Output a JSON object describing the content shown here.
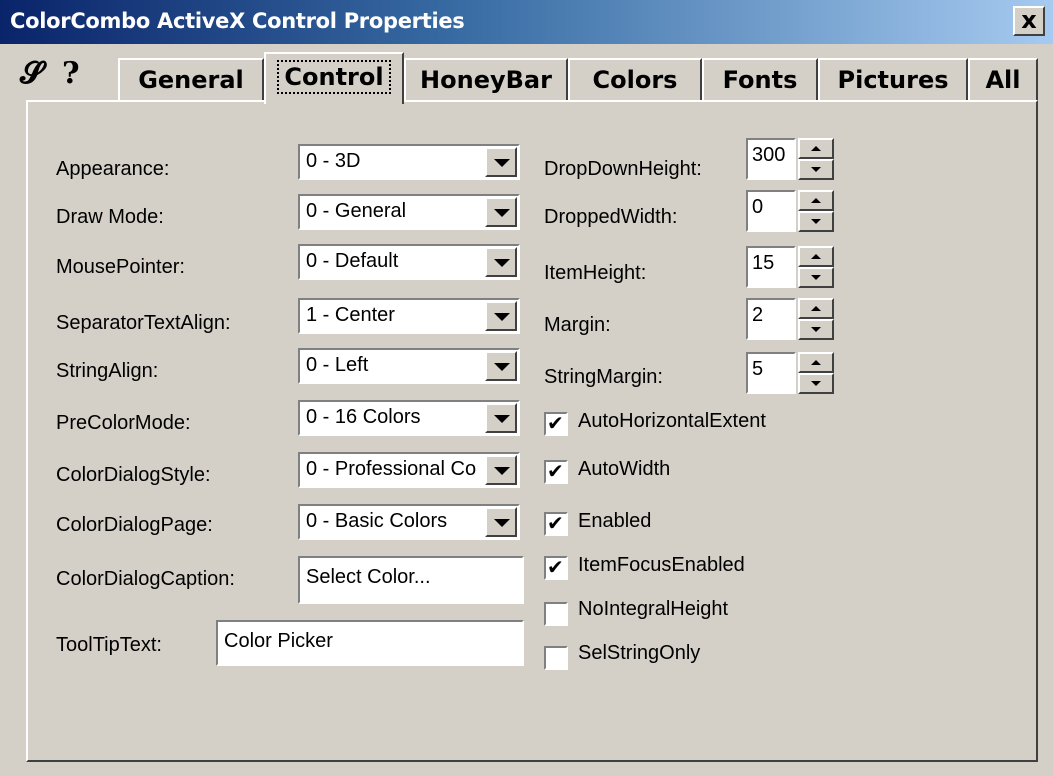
{
  "window": {
    "title": "ColorCombo ActiveX Control Properties",
    "close_glyph": "x"
  },
  "icons": [
    "pin-icon",
    "help-icon"
  ],
  "tabs": [
    {
      "label": "General",
      "active": false
    },
    {
      "label": "Control",
      "active": true
    },
    {
      "label": "HoneyBar",
      "active": false
    },
    {
      "label": "Colors",
      "active": false
    },
    {
      "label": "Fonts",
      "active": false
    },
    {
      "label": "Pictures",
      "active": false
    },
    {
      "label": "All",
      "active": false
    }
  ],
  "left": {
    "appearance": {
      "label": "Appearance:",
      "value": "0 - 3D"
    },
    "draw_mode": {
      "label": "Draw Mode:",
      "value": "0 - General"
    },
    "mouse_pointer": {
      "label": "MousePointer:",
      "value": "0 - Default"
    },
    "separator_text_align": {
      "label": "SeparatorTextAlign:",
      "value": "1 - Center"
    },
    "string_align": {
      "label": "StringAlign:",
      "value": "0 - Left"
    },
    "pre_color_mode": {
      "label": "PreColorMode:",
      "value": "0 - 16 Colors"
    },
    "color_dialog_style": {
      "label": "ColorDialogStyle:",
      "value": "0 - Professional Co"
    },
    "color_dialog_page": {
      "label": "ColorDialogPage:",
      "value": "0 - Basic Colors"
    },
    "color_dialog_caption": {
      "label": "ColorDialogCaption:",
      "value": "Select Color..."
    },
    "tooltip_text": {
      "label": "ToolTipText:",
      "value": "Color Picker"
    }
  },
  "right": {
    "dropdown_height": {
      "label": "DropDownHeight:",
      "value": "300"
    },
    "dropped_width": {
      "label": "DroppedWidth:",
      "value": "0"
    },
    "item_height": {
      "label": "ItemHeight:",
      "value": "15"
    },
    "margin": {
      "label": "Margin:",
      "value": "2"
    },
    "string_margin": {
      "label": "StringMargin:",
      "value": "5"
    }
  },
  "checks": {
    "auto_horizontal_extent": {
      "label": "AutoHorizontalExtent",
      "checked": true
    },
    "auto_width": {
      "label": "AutoWidth",
      "checked": true
    },
    "enabled": {
      "label": "Enabled",
      "checked": true
    },
    "item_focus_enabled": {
      "label": "ItemFocusEnabled",
      "checked": true
    },
    "no_integral_height": {
      "label": "NoIntegralHeight",
      "checked": false
    },
    "sel_string_only": {
      "label": "SelStringOnly",
      "checked": false
    }
  }
}
